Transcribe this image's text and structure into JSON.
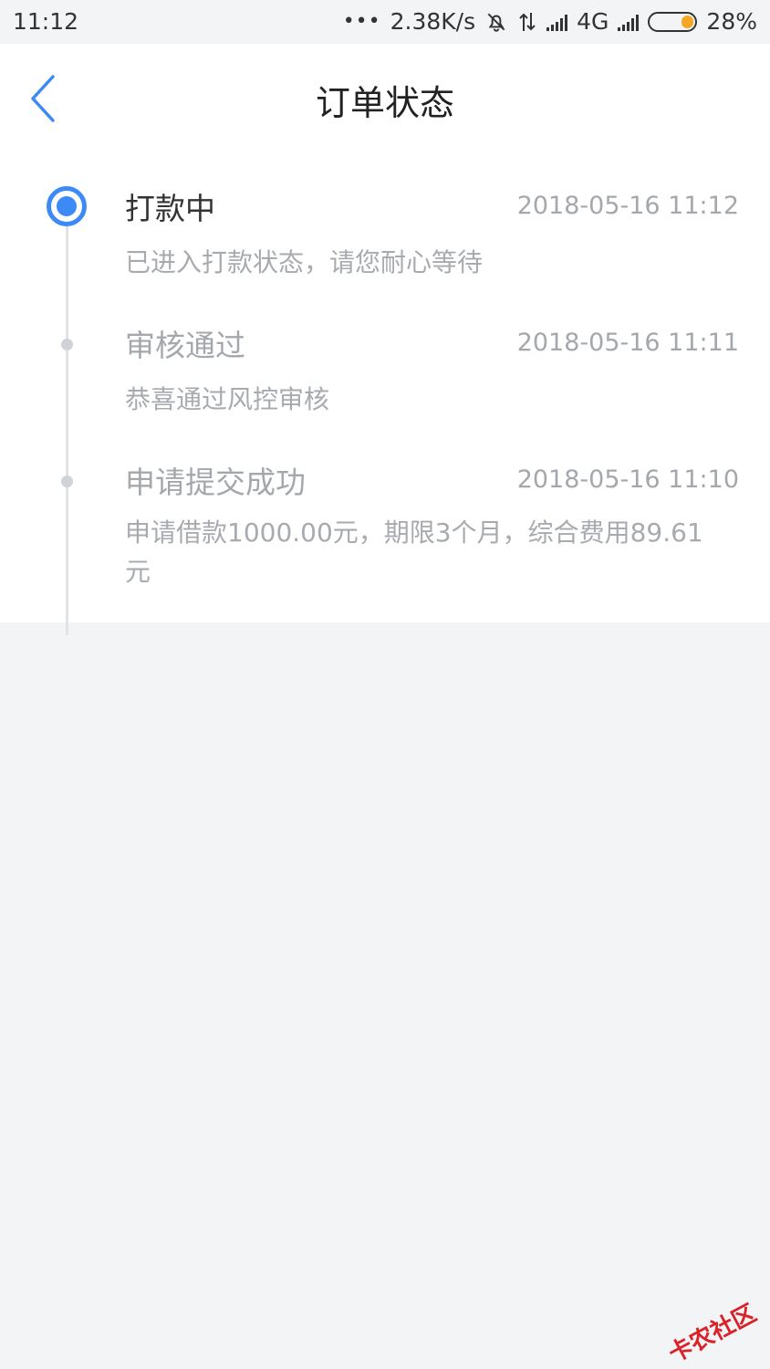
{
  "status_bar": {
    "time": "11:12",
    "dots": "•••",
    "speed": "2.38K/s",
    "network": "4G",
    "battery": "28%"
  },
  "header": {
    "title": "订单状态",
    "back_icon": "chevron-left-icon"
  },
  "steps": [
    {
      "name": "打款中",
      "time": "2018-05-16 11:12",
      "desc": "已进入打款状态，请您耐心等待",
      "active": true
    },
    {
      "name": "审核通过",
      "time": "2018-05-16 11:11",
      "desc": "恭喜通过风控审核",
      "active": false
    },
    {
      "name": "申请提交成功",
      "time": "2018-05-16 11:10",
      "desc": "申请借款1000.00元，期限3个月，综合费用89.61元",
      "active": false
    }
  ],
  "watermark": "卡农社区",
  "colors": {
    "accent": "#3d8af7",
    "background": "#f3f4f6",
    "battery": "#f5a623"
  }
}
